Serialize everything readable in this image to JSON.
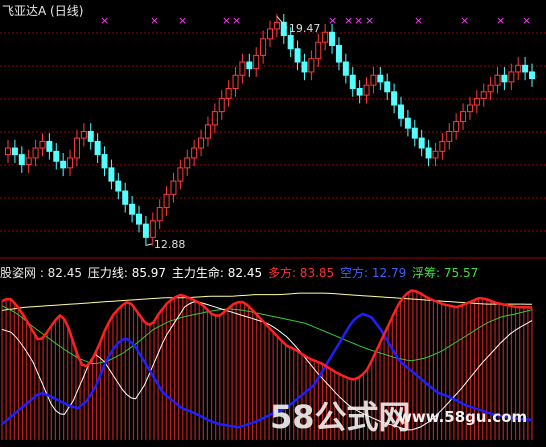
{
  "header": {
    "title": "飞亚达A (日线)"
  },
  "price_chart": {
    "high_label": "19.47",
    "low_label": "12.88"
  },
  "indicator": {
    "name_label": "股姿网 : 82.45",
    "pressure_label": "压力线: 85.97",
    "main_life_label": "主力生命: 82.45",
    "long_label": "多方: 83.85",
    "short_label": "空方: 12.79",
    "float_label": "浮筹: 75.57"
  },
  "watermark": {
    "logo": "58公式网",
    "url": "www.58gu.com"
  },
  "colors": {
    "up": "#ff3b3b",
    "down": "#54ffff",
    "long": "#ff2020",
    "short": "#2020ff",
    "pressure": "#ffffa0",
    "life": "#38c838",
    "float": "#ffffff",
    "grid": "#a00000",
    "marker": "#ff40ff"
  },
  "chart_data": [
    {
      "type": "candlestick",
      "title": "飞亚达A (日线)",
      "annotations": [
        "19.47",
        "12.88"
      ],
      "ylim": [
        12.88,
        19.47
      ],
      "values": [
        15.6,
        15.4,
        15.1,
        15.3,
        15.6,
        15.8,
        15.5,
        15.2,
        15.0,
        15.3,
        15.9,
        16.1,
        15.8,
        15.4,
        15.0,
        14.6,
        14.3,
        13.9,
        13.6,
        13.3,
        12.9,
        13.4,
        13.8,
        14.2,
        14.6,
        15.0,
        15.3,
        15.6,
        15.9,
        16.3,
        16.7,
        17.1,
        17.4,
        17.8,
        18.2,
        18.0,
        18.4,
        18.9,
        19.2,
        19.4,
        19.0,
        18.6,
        18.2,
        17.9,
        18.3,
        18.8,
        19.1,
        18.7,
        18.2,
        17.8,
        17.4,
        17.2,
        17.5,
        17.8,
        17.6,
        17.3,
        16.9,
        16.5,
        16.2,
        15.9,
        15.6,
        15.3,
        15.5,
        15.8,
        16.1,
        16.4,
        16.7,
        16.9,
        17.1,
        17.3,
        17.5,
        17.8,
        17.6,
        17.9,
        18.1,
        17.9,
        17.7
      ]
    },
    {
      "type": "line",
      "title": "",
      "ylim": [
        0,
        100
      ],
      "series": [
        {
          "name": "多方",
          "values": [
            88,
            90,
            85,
            78,
            70,
            62,
            68,
            75,
            80,
            70,
            55,
            45,
            50,
            60,
            72,
            80,
            85,
            88,
            82,
            75,
            72,
            80,
            86,
            90,
            92,
            90,
            88,
            85,
            80,
            78,
            82,
            86,
            88,
            85,
            80,
            75,
            70,
            65,
            60,
            58,
            55,
            52,
            50,
            48,
            45,
            42,
            40,
            38,
            40,
            45,
            55,
            65,
            75,
            85,
            92,
            95,
            93,
            90,
            88,
            86,
            85,
            84,
            86,
            88,
            90,
            89,
            87,
            86,
            85,
            84,
            84,
            83.85
          ]
        },
        {
          "name": "空方",
          "values": [
            10,
            15,
            20,
            25,
            30,
            28,
            25,
            22,
            20,
            25,
            35,
            50,
            60,
            65,
            60,
            50,
            40,
            30,
            25,
            20,
            18,
            15,
            12,
            10,
            9,
            8,
            10,
            12,
            15,
            18,
            20,
            25,
            30,
            35,
            45,
            55,
            65,
            75,
            80,
            78,
            70,
            60,
            50,
            45,
            40,
            35,
            30,
            28,
            25,
            22,
            20,
            18,
            16,
            15,
            14,
            13,
            12.79
          ]
        },
        {
          "name": "浮筹",
          "values": [
            70,
            68,
            60,
            50,
            35,
            20,
            15,
            25,
            40,
            55,
            50,
            40,
            30,
            25,
            35,
            50,
            65,
            75,
            85,
            88,
            86,
            84,
            82,
            80,
            78,
            76,
            74,
            70,
            65,
            58,
            50,
            42,
            35,
            28,
            22,
            18,
            15,
            12,
            10,
            8,
            6,
            8,
            12,
            18,
            25,
            32,
            40,
            48,
            55,
            62,
            68,
            72,
            75.57
          ]
        },
        {
          "name": "压力线",
          "values": [
            82,
            84,
            85,
            86,
            87,
            88,
            89,
            90,
            90,
            91,
            91,
            92,
            92,
            93,
            93,
            92,
            91,
            90,
            89,
            88,
            87,
            86,
            86,
            85.97
          ]
        },
        {
          "name": "主力生命",
          "values": [
            85,
            80,
            72,
            65,
            58,
            52,
            48,
            50,
            55,
            62,
            70,
            75,
            78,
            80,
            82,
            83,
            82,
            80,
            78,
            76,
            74,
            70,
            66,
            62,
            58,
            55,
            52,
            50,
            52,
            56,
            62,
            68,
            74,
            78,
            80,
            82.45
          ]
        }
      ]
    }
  ]
}
